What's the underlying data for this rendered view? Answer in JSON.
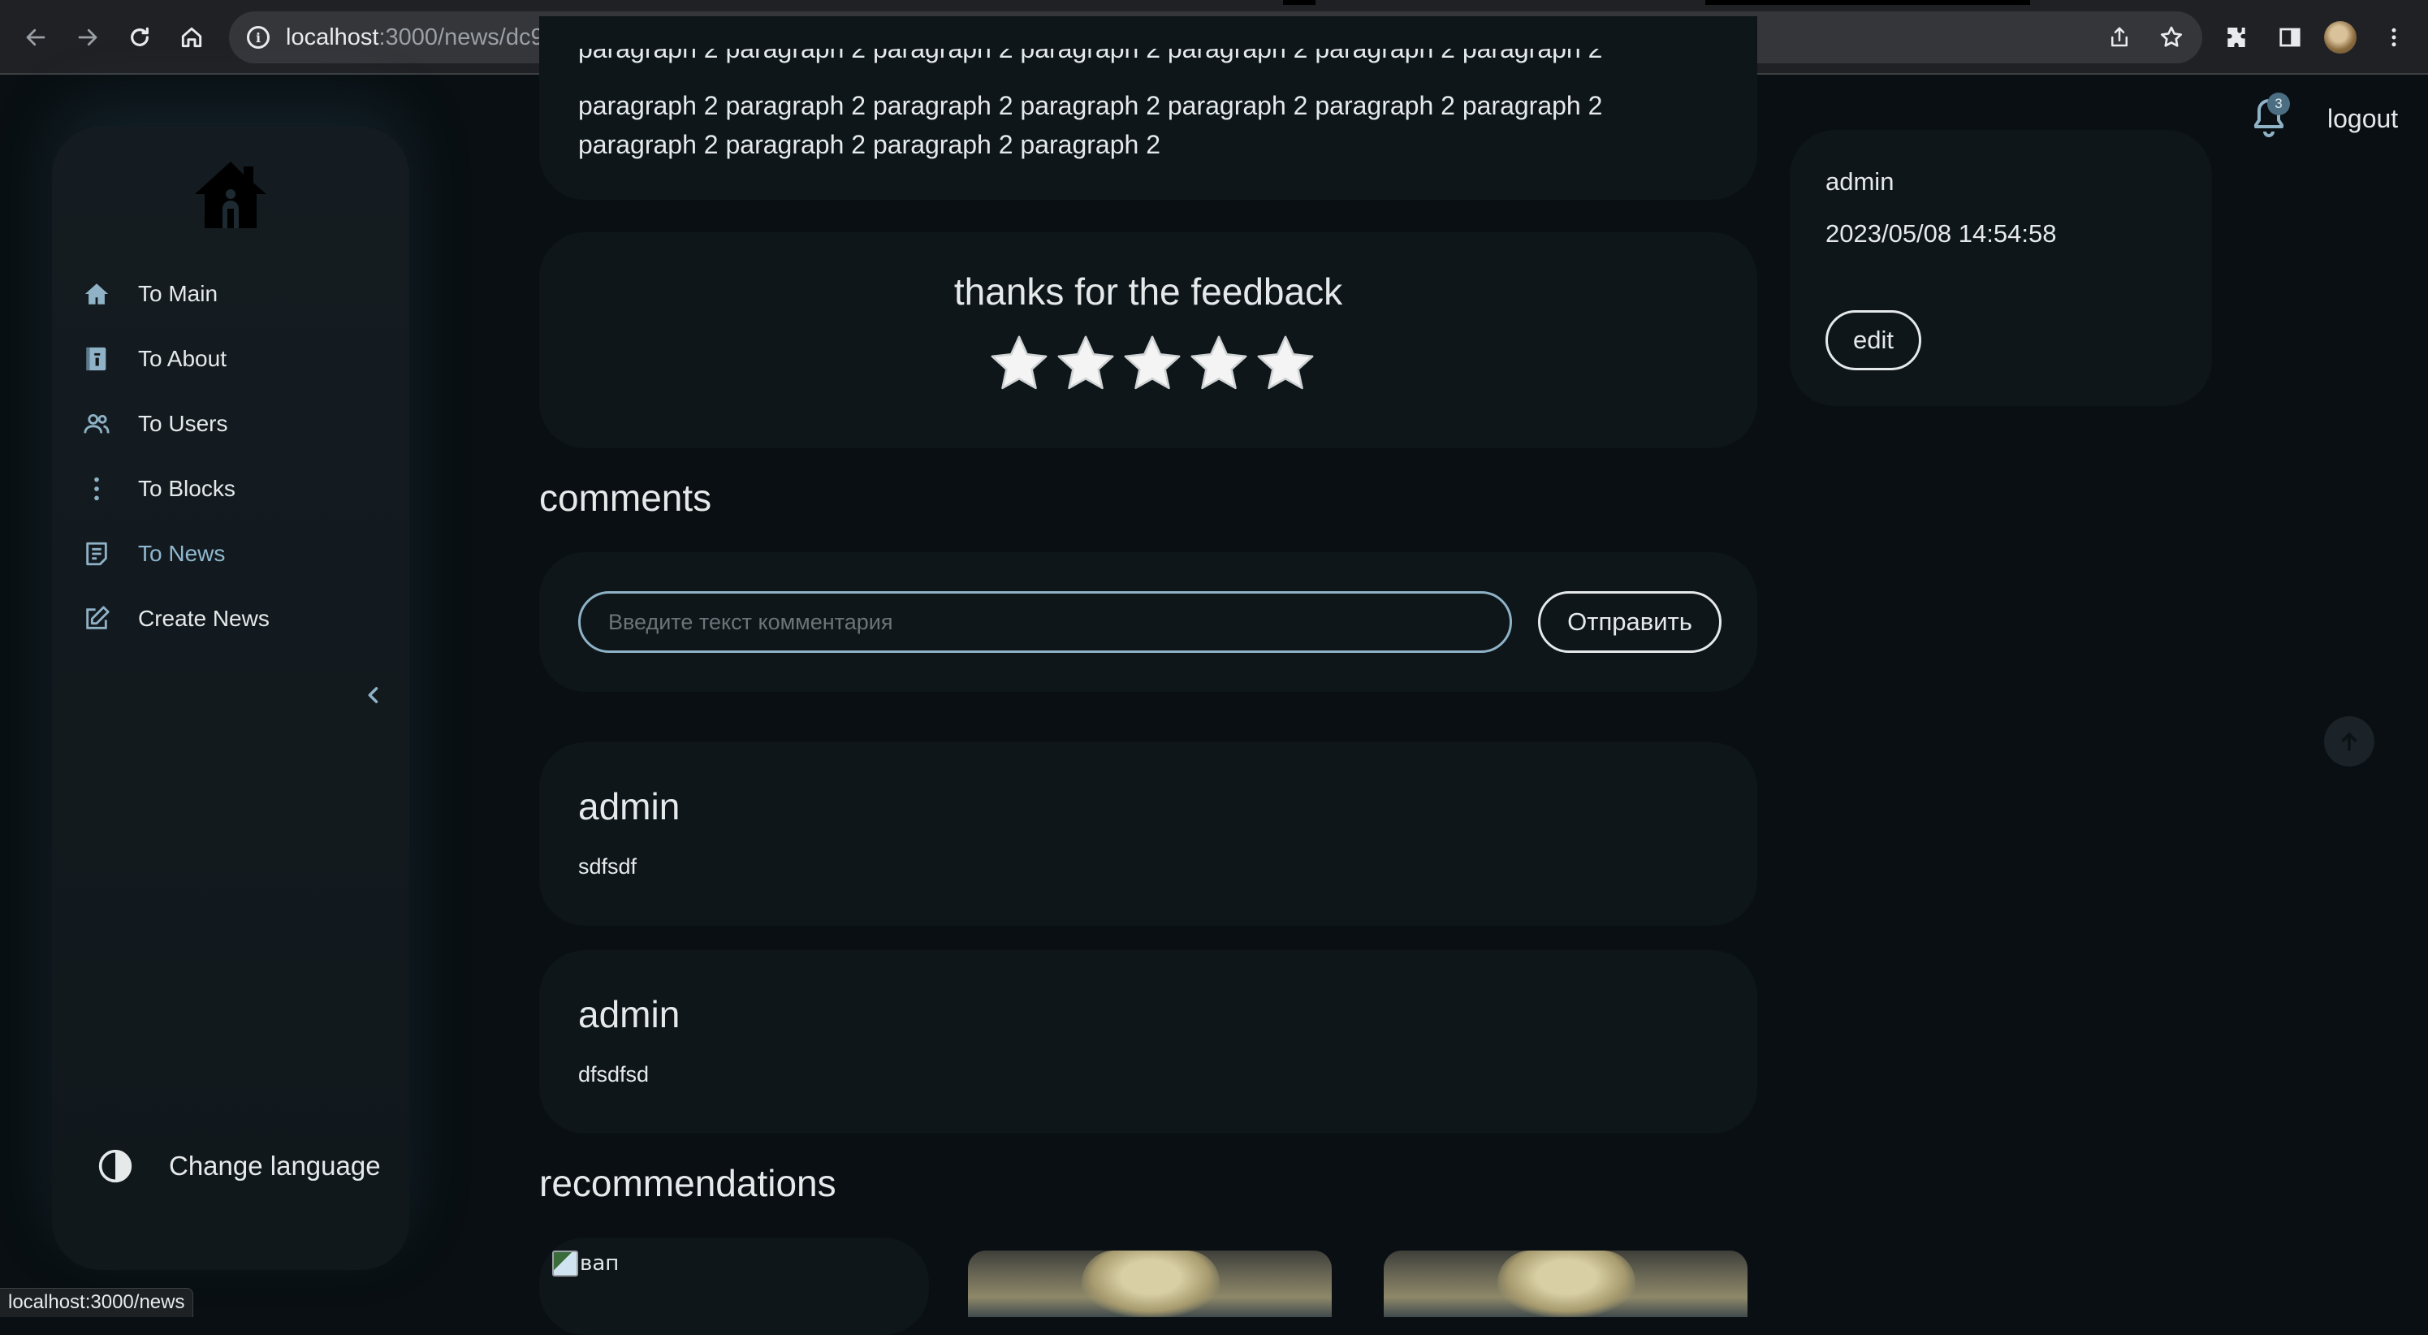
{
  "browser": {
    "url_host": "localhost",
    "url_rest": ":3000/news/dc9d2703-7669-445f-b09f-aa8df752b214",
    "status_url": "localhost:3000/news"
  },
  "sidebar": {
    "items": [
      {
        "label": "To Main",
        "icon": "home-icon"
      },
      {
        "label": "To About",
        "icon": "book-icon"
      },
      {
        "label": "To Users",
        "icon": "users-icon"
      },
      {
        "label": "To Blocks",
        "icon": "more-vertical-icon"
      },
      {
        "label": "To News",
        "icon": "article-icon",
        "active": true
      },
      {
        "label": "Create News",
        "icon": "edit-icon"
      }
    ],
    "change_language": "Change language"
  },
  "article": {
    "paragraph_cut": "paragraph 2 paragraph 2 paragraph 2 paragraph 2 paragraph 2 paragraph 2 paragraph 2",
    "paragraph_line1": "paragraph 2 paragraph 2 paragraph 2 paragraph 2 paragraph 2 paragraph 2 paragraph 2",
    "paragraph_line2": "paragraph 2 paragraph 2 paragraph 2 paragraph 2"
  },
  "feedback": {
    "title": "thanks for the feedback",
    "rating": 5,
    "max_rating": 5
  },
  "comments": {
    "title": "comments",
    "input_placeholder": "Введите текст комментария",
    "send_label": "Отправить",
    "items": [
      {
        "author": "admin",
        "text": "sdfsdf"
      },
      {
        "author": "admin",
        "text": "dfsdfsd"
      }
    ]
  },
  "recommendations": {
    "title": "recommendations",
    "first_alt": "вап"
  },
  "info": {
    "author": "admin",
    "date": "2023/05/08 14:54:58",
    "edit_label": "edit"
  },
  "header": {
    "notifications_count": "3",
    "logout_label": "logout"
  },
  "colors": {
    "background": "#090f12",
    "card": "#0e161a",
    "accent": "#8fb2c7",
    "text": "#e6e9ea"
  }
}
